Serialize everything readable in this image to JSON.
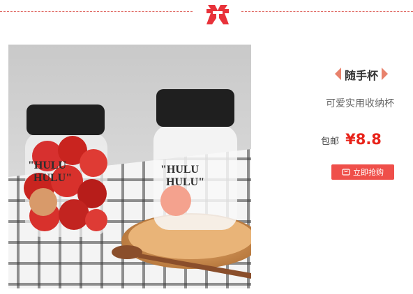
{
  "divider": {
    "mark_icon": "brand-logo-icon",
    "color": "#e8323a"
  },
  "product": {
    "image_icon": "product-photo",
    "name": "随手杯",
    "subtitle": "可爱实用收纳杯",
    "price_prefix": "包邮",
    "price": "¥8.8",
    "price_color": "#e8231a",
    "buy_button_label": "立即抢购",
    "buy_button_icon": "cart-icon",
    "button_color": "#ef4f4a",
    "jar_label_text": "HULU HULU"
  }
}
